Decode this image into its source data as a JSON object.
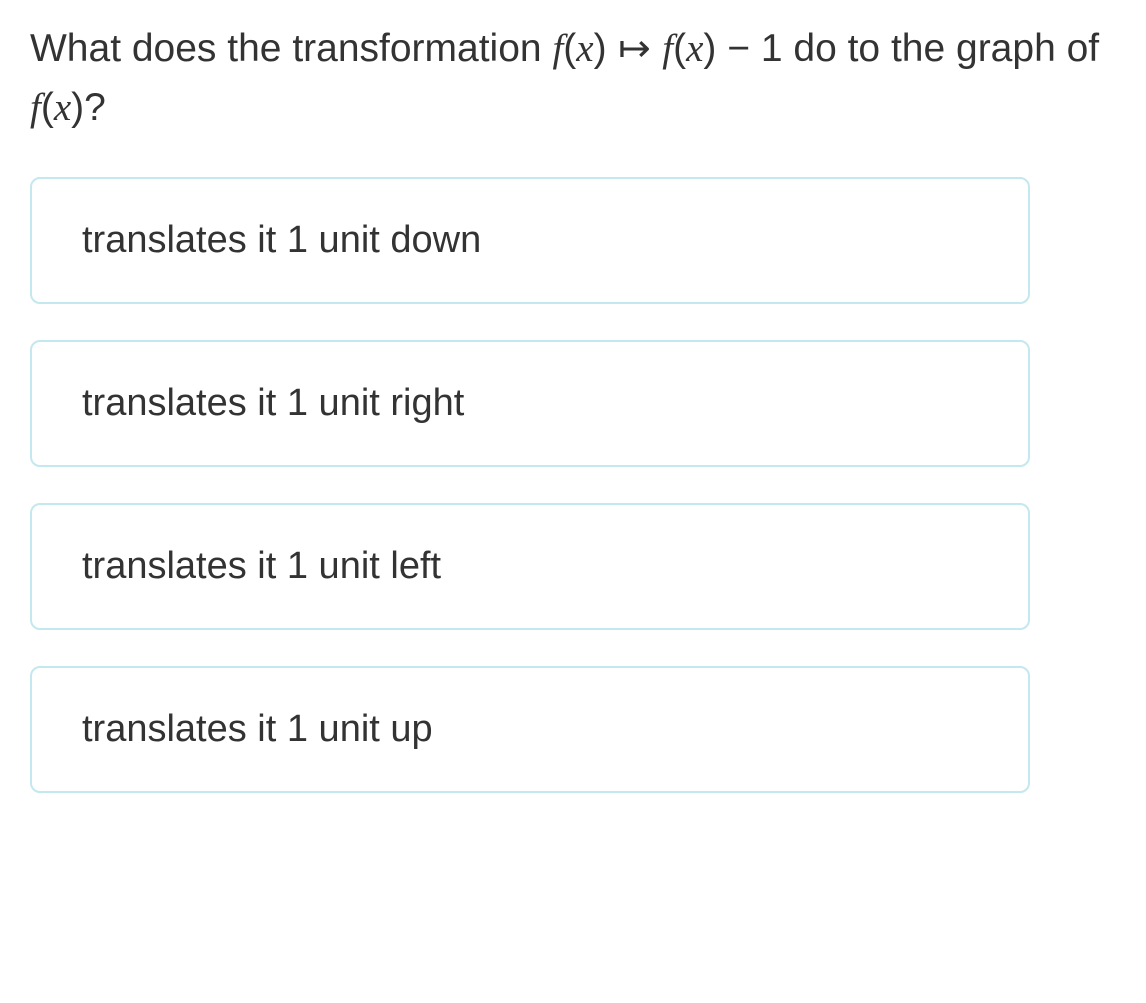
{
  "question": {
    "part1": "What does the transformation ",
    "f1": "f",
    "p1": "(",
    "x1": "x",
    "p2": ") ",
    "arrow": "↦",
    "sp": " ",
    "f2": "f",
    "p3": "(",
    "x2": "x",
    "p4": ") − 1 do to the graph of ",
    "f3": "f",
    "p5": "(",
    "x3": "x",
    "p6": ")?"
  },
  "answers": [
    {
      "label": "translates it 1 unit down"
    },
    {
      "label": "translates it 1 unit right"
    },
    {
      "label": "translates it 1 unit left"
    },
    {
      "label": "translates it 1 unit up"
    }
  ]
}
